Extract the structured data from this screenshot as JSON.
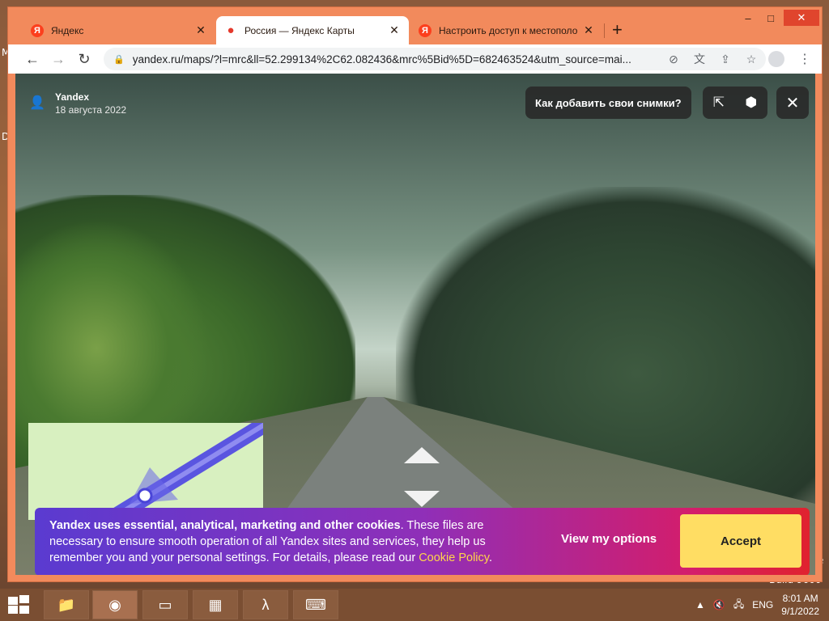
{
  "desktop": {
    "edge_text_top": "M",
    "edge_text_mid": "D",
    "build_text": "Build 9600",
    "edge_text_right": "e"
  },
  "browser": {
    "tabs": [
      {
        "label": "Яндекс",
        "favicon": "yandex-icon",
        "active": false
      },
      {
        "label": "Россия — Яндекс Карты",
        "favicon": "map-pin-icon",
        "active": true
      },
      {
        "label": "Настроить доступ к местополо",
        "favicon": "yandex-icon",
        "active": false
      }
    ],
    "new_tab": "+",
    "window_controls": {
      "minimize": "–",
      "maximize": "□",
      "close": "✕"
    },
    "nav": {
      "back": "←",
      "forward": "→",
      "reload": "↻"
    },
    "url": "yandex.ru/maps/?l=mrc&ll=52.299134%2C62.082436&mrc%5Bid%5D=682463524&utm_source=mai..."
  },
  "panorama": {
    "author_name": "Yandex",
    "author_date": "18 августа 2022",
    "add_photos_button": "Как добавить свои снимки?",
    "share_icon": "share-icon",
    "report_icon": "report-icon",
    "close_icon": "close-icon"
  },
  "cookie": {
    "bold_text": "Yandex uses essential, analytical, marketing and other cookies",
    "body_text": ". These files are necessary to ensure smooth operation of all Yandex sites and services, they help us remember you and your personal settings. For details, please read our ",
    "link_text": "Cookie Policy",
    "end_text": ".",
    "view_options": "View my options",
    "accept": "Accept"
  },
  "taskbar": {
    "language": "ENG",
    "time": "8:01 AM",
    "date": "9/1/2022"
  },
  "colors": {
    "accept_bg": "#ffdd63",
    "cookie_link": "#ffd54a",
    "titlebar": "#f28a5c"
  }
}
